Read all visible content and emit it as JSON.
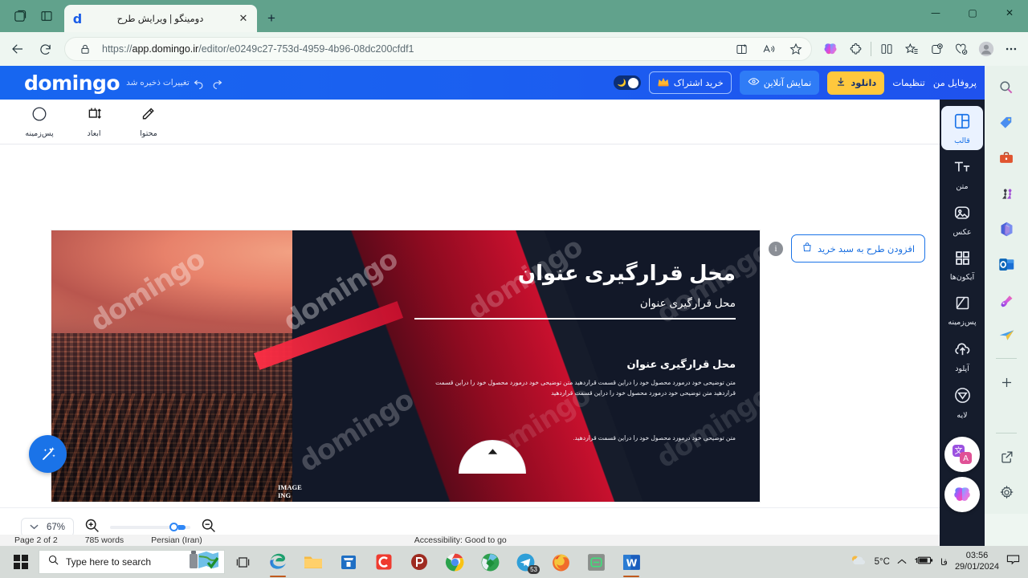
{
  "browser": {
    "tab": {
      "title": "دومینگو | ویرایش طرح",
      "favicon": "d",
      "close_label": "✕"
    },
    "newtab_label": "+",
    "url_prefix": "https://",
    "url_domain": "app.domingo.ir",
    "url_path": "/editor/e0249c27-753d-4959-4b96-08dc200cfdf1",
    "window_controls": {
      "minimize": "—",
      "maximize": "▢",
      "close": "✕"
    }
  },
  "app": {
    "logo": "domingo",
    "saved_note": "تغییرات ذخیره شد",
    "header": {
      "profile": "پروفایل من",
      "settings": "تنظیمات",
      "download": "دانلود",
      "preview": "نمایش آنلاین",
      "subscribe": "خرید اشتراک"
    },
    "subtoolbar": [
      {
        "label": "پس‌زمینه",
        "icon": "circle-icon"
      },
      {
        "label": "ابعاد",
        "icon": "resize-icon"
      },
      {
        "label": "محتوا",
        "icon": "edit-pencil-icon"
      }
    ],
    "cart_button": "افزودن طرح به سبد خرید",
    "zoom": {
      "value": "67%"
    },
    "rail": [
      {
        "label": "قالب",
        "icon": "layout-icon",
        "active": true
      },
      {
        "label": "متن",
        "icon": "text-icon",
        "active": false
      },
      {
        "label": "عکس",
        "icon": "image-icon",
        "active": false
      },
      {
        "label": "آیکون‌ها",
        "icon": "grid-icon",
        "active": false
      },
      {
        "label": "پس‌زمینه",
        "icon": "background-icon",
        "active": false
      },
      {
        "label": "آپلود",
        "icon": "upload-cloud-icon",
        "active": false
      },
      {
        "label": "لایه",
        "icon": "shape-icon",
        "active": false
      }
    ]
  },
  "design": {
    "title": "محل قرارگیری عنوان",
    "subtitle": "محل قرارگیری عنوان",
    "heading2": "محل قرارگیری عنوان",
    "body": "متن توضیحی خود درمورد محصول خود را دراین قسمت قراردهید  متن توضیحی خود درمورد محصول خود را دراین قسمت قراردهید متن توضیحی خود درمورد محصول خود را دراین قسمت قراردهید",
    "body2": "متن توضیحی خود درمورد محصول خود را دراین قسمت قراردهید.",
    "image_credit": "IMAGE\nING",
    "watermark": "domingo"
  },
  "word_status": {
    "page": "Page 2 of 2",
    "words": "785 words",
    "lang": "Persian (Iran)",
    "accessibility": "Accessibility: Good to go"
  },
  "taskbar": {
    "search_placeholder": "Type here to search",
    "apps": [
      "edge-icon",
      "file-explorer-icon",
      "microsoft-store-icon",
      "c-app-icon",
      "p-app-icon",
      "chrome-icon",
      "idm-icon",
      "telegram-icon",
      "firefox-icon",
      "green-app-icon",
      "word-icon"
    ],
    "telegram_badge": "53",
    "weather": "5°C",
    "language": "فا",
    "time": "03:56",
    "date": "29/01/2024"
  },
  "colors": {
    "accent_blue": "#1a73e8",
    "header_blue": "#1766f0",
    "gold": "#ffc83d",
    "rail_dark": "#151c2c",
    "titlebar_green": "#61a28c"
  }
}
